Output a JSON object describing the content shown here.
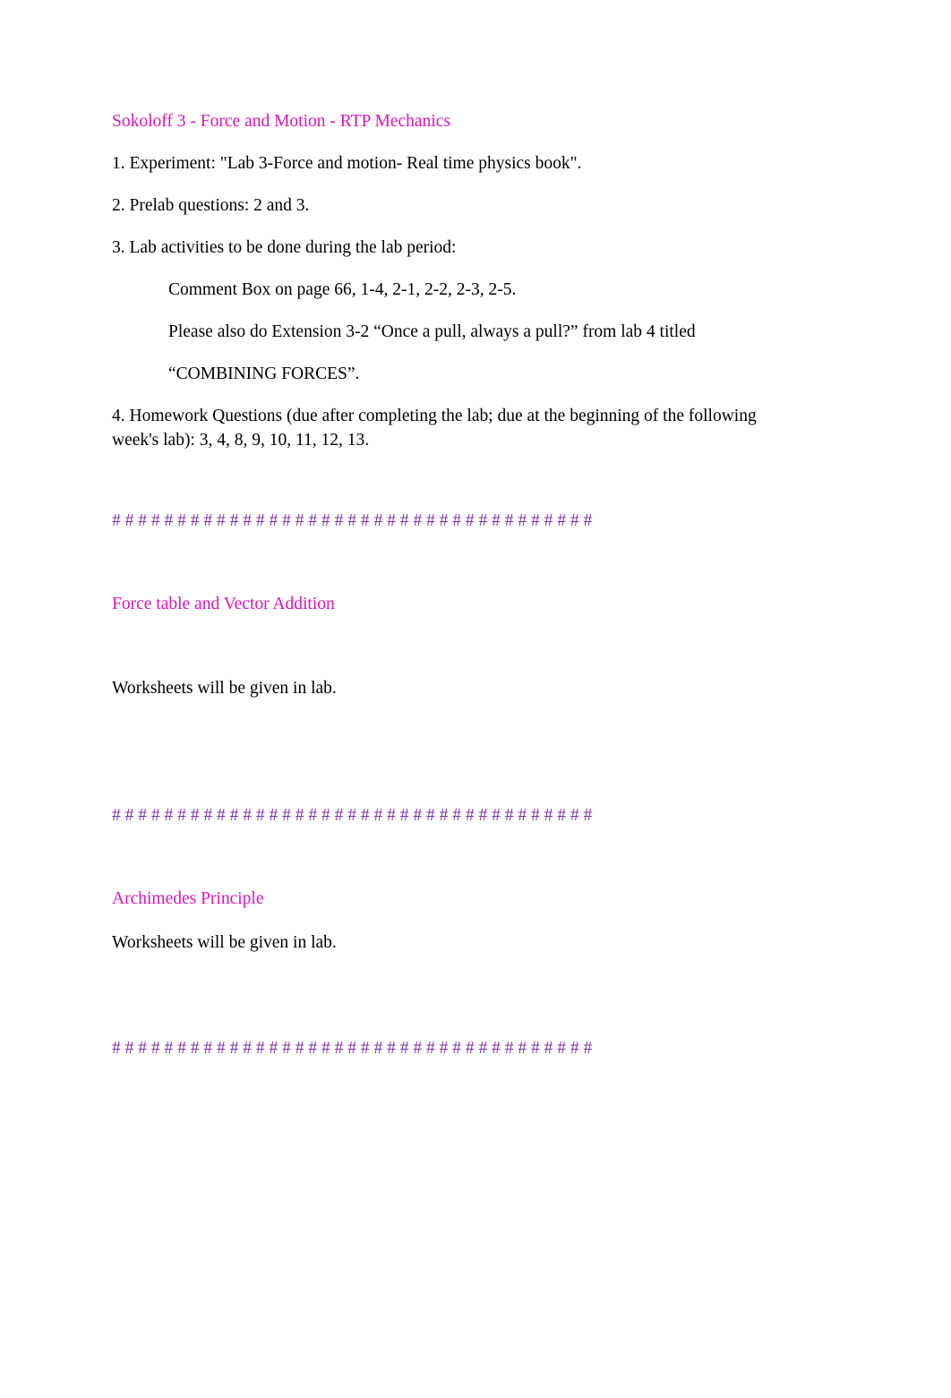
{
  "document": {
    "background_color": "#ffffff",
    "heading_color": "#d915b8",
    "body_color": "#000000",
    "separator_color": "#7b34ae",
    "separator_line": "# # # # # # # # # # # # # # # # # # # # # # # # # # # # # # # # # # # # #"
  },
  "sections": [
    {
      "heading": "Sokoloff 3 - Force and Motion - RTP Mechanics",
      "items": [
        "1. Experiment: \"Lab 3-Force and motion- Real time physics book\".",
        "2. Prelab questions: 2 and 3.",
        "3. Lab activities to be done during the lab period:"
      ],
      "indented": [
        "Comment Box on page 66, 1-4, 2-1, 2-2, 2-3, 2-5.",
        "Please also do Extension 3-2 “Once a pull, always a pull?” from lab 4 titled",
        "“COMBINING FORCES”."
      ],
      "closing": "4. Homework Questions (due after completing the lab; due at the beginning of the following week's lab): 3, 4, 8, 9, 10, 11, 12, 13."
    },
    {
      "heading": "Force table and Vector Addition",
      "body": "Worksheets will be given in lab."
    },
    {
      "heading": "Archimedes Principle",
      "body": "Worksheets will be given in lab."
    }
  ]
}
